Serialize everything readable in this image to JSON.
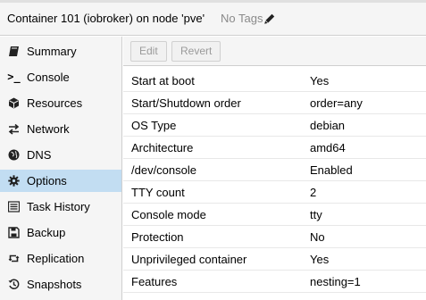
{
  "header": {
    "title": "Container 101 (iobroker) on node 'pve'",
    "tags": "No Tags",
    "edit_tags_icon": "pencil-icon"
  },
  "sidebar": {
    "items": [
      {
        "label": "Summary",
        "icon": "book-icon"
      },
      {
        "label": "Console",
        "icon": "terminal-icon"
      },
      {
        "label": "Resources",
        "icon": "cube-icon"
      },
      {
        "label": "Network",
        "icon": "exchange-icon"
      },
      {
        "label": "DNS",
        "icon": "globe-icon"
      },
      {
        "label": "Options",
        "icon": "gear-icon",
        "active": true
      },
      {
        "label": "Task History",
        "icon": "list-icon"
      },
      {
        "label": "Backup",
        "icon": "floppy-icon"
      },
      {
        "label": "Replication",
        "icon": "retweet-icon"
      },
      {
        "label": "Snapshots",
        "icon": "history-icon"
      }
    ]
  },
  "toolbar": {
    "edit_label": "Edit",
    "revert_label": "Revert"
  },
  "options": {
    "rows": [
      {
        "key": "Start at boot",
        "value": "Yes"
      },
      {
        "key": "Start/Shutdown order",
        "value": "order=any"
      },
      {
        "key": "OS Type",
        "value": "debian"
      },
      {
        "key": "Architecture",
        "value": "amd64"
      },
      {
        "key": "/dev/console",
        "value": "Enabled"
      },
      {
        "key": "TTY count",
        "value": "2"
      },
      {
        "key": "Console mode",
        "value": "tty"
      },
      {
        "key": "Protection",
        "value": "No"
      },
      {
        "key": "Unprivileged container",
        "value": "Yes"
      },
      {
        "key": "Features",
        "value": "nesting=1"
      }
    ]
  },
  "colors": {
    "active_nav": "#c2ddf2",
    "panel_bg": "#f5f5f5",
    "muted_text": "#8a8a8a"
  }
}
